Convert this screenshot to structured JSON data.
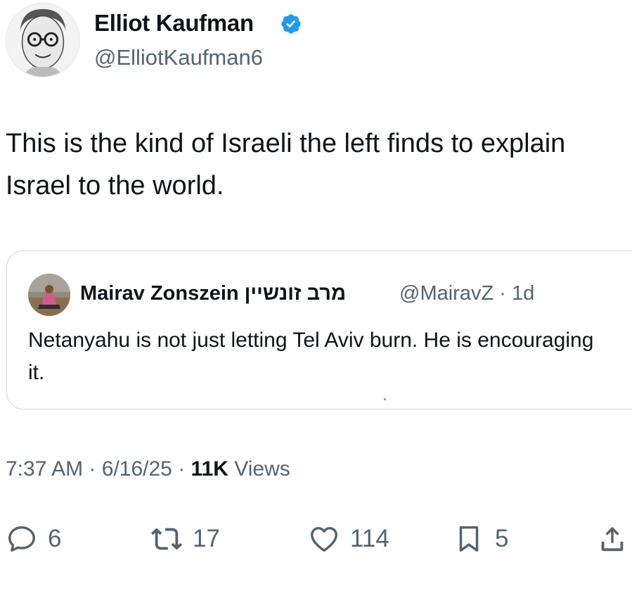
{
  "author": {
    "name": "Elliot Kaufman",
    "handle": "@ElliotKaufman6",
    "verified": true,
    "verified_color": "#1d9bf0"
  },
  "tweet": {
    "text": "This is the kind of Israeli the left finds to explain Israel to the world."
  },
  "quoted_tweet": {
    "author_name": "Mairav Zonszein מרב זונשיין",
    "handle": "@MairavZ",
    "separator": "·",
    "age": "1d",
    "text": "Netanyahu is not just letting Tel Aviv burn. He is encouraging it."
  },
  "meta": {
    "time": "7:37 AM",
    "sep1": "·",
    "date": "6/16/25",
    "sep2": "·",
    "views_count": "11K",
    "views_label": "Views"
  },
  "actions": {
    "replies": "6",
    "reposts": "17",
    "likes": "114",
    "bookmarks": "5"
  },
  "icons": {
    "reply": "reply-icon",
    "repost": "repost-icon",
    "like": "heart-icon",
    "bookmark": "bookmark-icon",
    "share": "share-icon"
  },
  "colors": {
    "text": "#0f1419",
    "secondary": "#536471",
    "border": "#cfd9de"
  }
}
